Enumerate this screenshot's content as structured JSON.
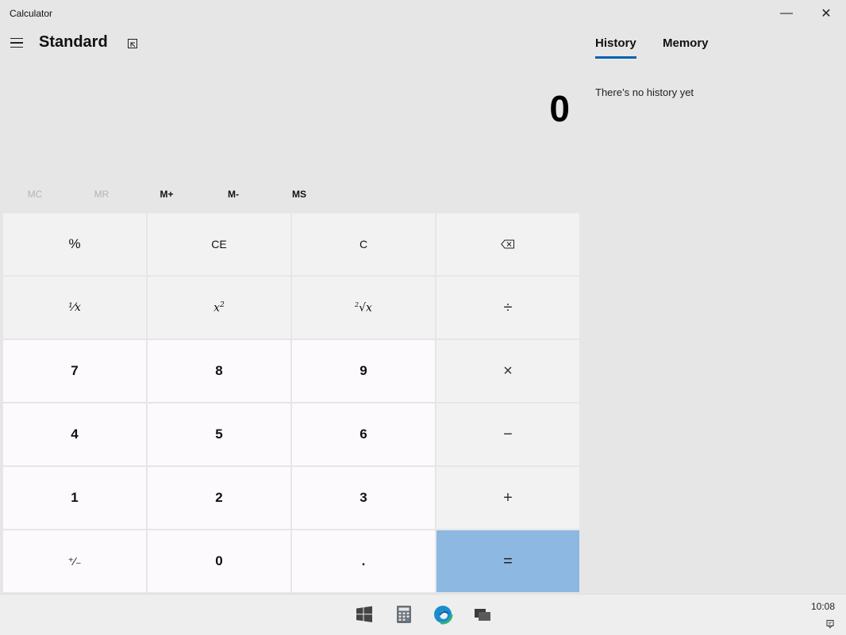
{
  "window": {
    "title": "Calculator",
    "minimize": "—",
    "close": "✕"
  },
  "header": {
    "mode": "Standard"
  },
  "display": {
    "value": "0"
  },
  "memory": [
    {
      "label": "MC",
      "enabled": false
    },
    {
      "label": "MR",
      "enabled": false
    },
    {
      "label": "M+",
      "enabled": true
    },
    {
      "label": "M-",
      "enabled": true
    },
    {
      "label": "MS",
      "enabled": true
    }
  ],
  "keys": {
    "percent": "%",
    "ce": "CE",
    "c": "C",
    "divide": "÷",
    "seven": "7",
    "eight": "8",
    "nine": "9",
    "multiply": "×",
    "four": "4",
    "five": "5",
    "six": "6",
    "minus": "−",
    "one": "1",
    "two": "2",
    "three": "3",
    "plus": "+",
    "negate": "⁺∕₋",
    "zero": "0",
    "decimal": ".",
    "equals": "="
  },
  "side_panel": {
    "tabs": [
      {
        "label": "History",
        "active": true
      },
      {
        "label": "Memory",
        "active": false
      }
    ],
    "empty_message": "There’s no history yet"
  },
  "taskbar": {
    "time": "10:08"
  },
  "colors": {
    "accent": "#0063b1",
    "equals": "#8cb8e2",
    "background": "#e6e6e6"
  },
  "icons": [
    "menu-icon",
    "keep-on-top-icon",
    "backspace-icon",
    "windows-start-icon",
    "calculator-app-icon",
    "edge-icon",
    "task-view-icon",
    "notification-icon"
  ]
}
